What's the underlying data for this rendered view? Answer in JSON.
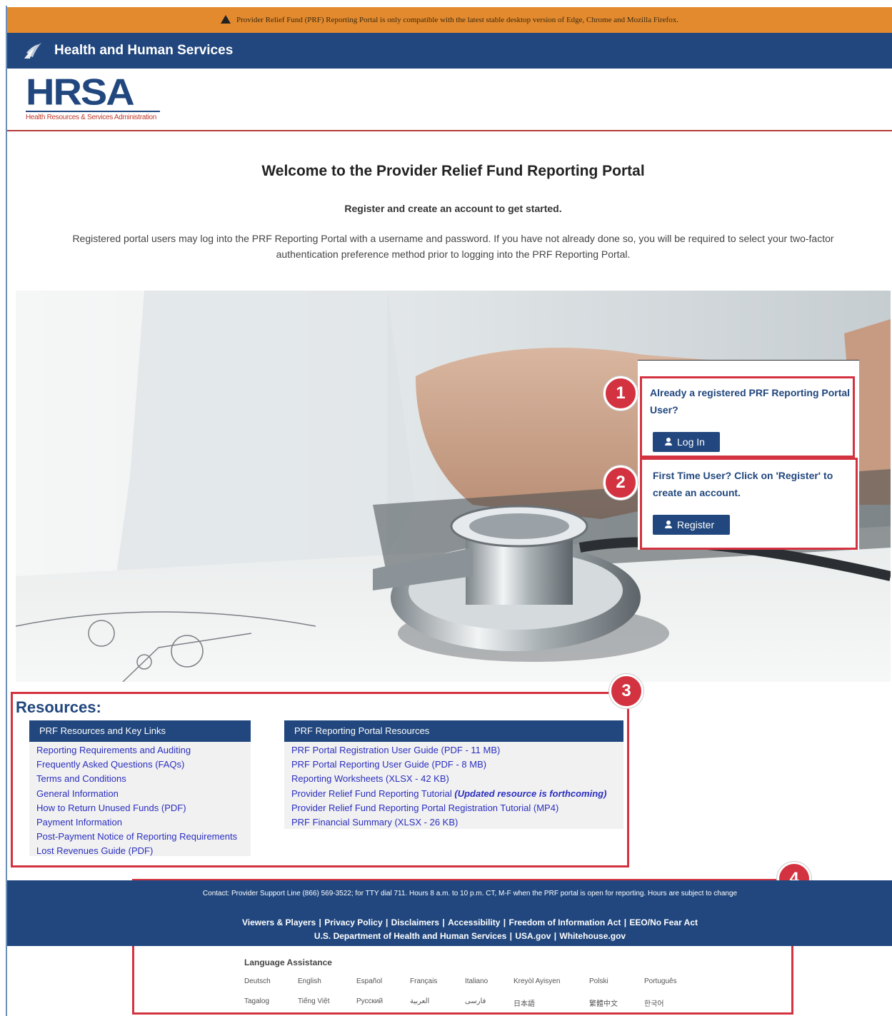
{
  "banner": {
    "text": "Provider Relief Fund (PRF) Reporting Portal is only compatible with the latest stable desktop version of Edge, Chrome and Mozilla Firefox."
  },
  "header": {
    "agency": "Health and Human Services",
    "logo_text": "HRSA",
    "logo_subtext": "Health Resources & Services Administration"
  },
  "main": {
    "welcome": "Welcome to the Provider Relief Fund Reporting Portal",
    "subheading": "Register and create an account to get started.",
    "intro": "Registered portal users may log into the PRF Reporting Portal with a username and password. If you have not already done so, you will be required to select your two-factor authentication preference method prior to logging into the PRF Reporting Portal."
  },
  "login_card": {
    "registered_prompt": "Already a registered PRF Reporting Portal User?",
    "login_label": "Log In",
    "first_time_prompt": "First Time User? Click on 'Register' to create an account.",
    "register_label": "Register"
  },
  "callouts": [
    "1",
    "2",
    "3",
    "4"
  ],
  "resources": {
    "title": "Resources:",
    "key_links": {
      "heading": "PRF Resources and Key Links",
      "items": [
        "Reporting Requirements and Auditing",
        "Frequently Asked Questions (FAQs)",
        "Terms and Conditions",
        "General Information",
        "How to Return Unused Funds (PDF)",
        "Payment Information",
        "Post-Payment Notice of Reporting Requirements",
        "Lost Revenues Guide (PDF)"
      ]
    },
    "portal": {
      "heading": "PRF Reporting Portal Resources",
      "items": [
        "PRF Portal Registration User Guide (PDF - 11 MB)",
        "PRF Portal Reporting User Guide (PDF - 8 MB)",
        "Reporting Worksheets (XLSX - 42 KB)",
        "Provider Relief Fund Reporting Tutorial",
        "Provider Relief Fund Reporting Portal Registration Tutorial (MP4)",
        "PRF Financial Summary (XLSX - 26 KB)"
      ],
      "tutorial_note": "(Updated resource is forthcoming)"
    }
  },
  "footer": {
    "contact": "Contact: Provider Support Line (866) 569-3522; for TTY dial 711. Hours 8 a.m. to 10 p.m. CT, M-F when the PRF portal is open for reporting. Hours are subject to change",
    "links_row1": [
      "Viewers & Players",
      "Privacy Policy",
      "Disclaimers",
      "Accessibility",
      "Freedom of Information Act",
      "EEO/No Fear Act"
    ],
    "links_row2": [
      "U.S. Department of Health and Human Services",
      "USA.gov",
      "Whitehouse.gov"
    ],
    "language_title": "Language Assistance",
    "languages_row1": [
      "Deutsch",
      "English",
      "Español",
      "Français",
      "Italiano",
      "Kreyòl Ayisyen",
      "Polski",
      "Português"
    ],
    "languages_row2": [
      "Tagalog",
      "Tiếng Việt",
      "Русский",
      "العربية",
      "فارسی",
      "日本語",
      "繁體中文",
      "한국어"
    ]
  },
  "colors": {
    "navy": "#21477e",
    "banner_orange": "#e38a2e",
    "callout_red": "#d33340",
    "link_blue": "#2b2fbf"
  }
}
